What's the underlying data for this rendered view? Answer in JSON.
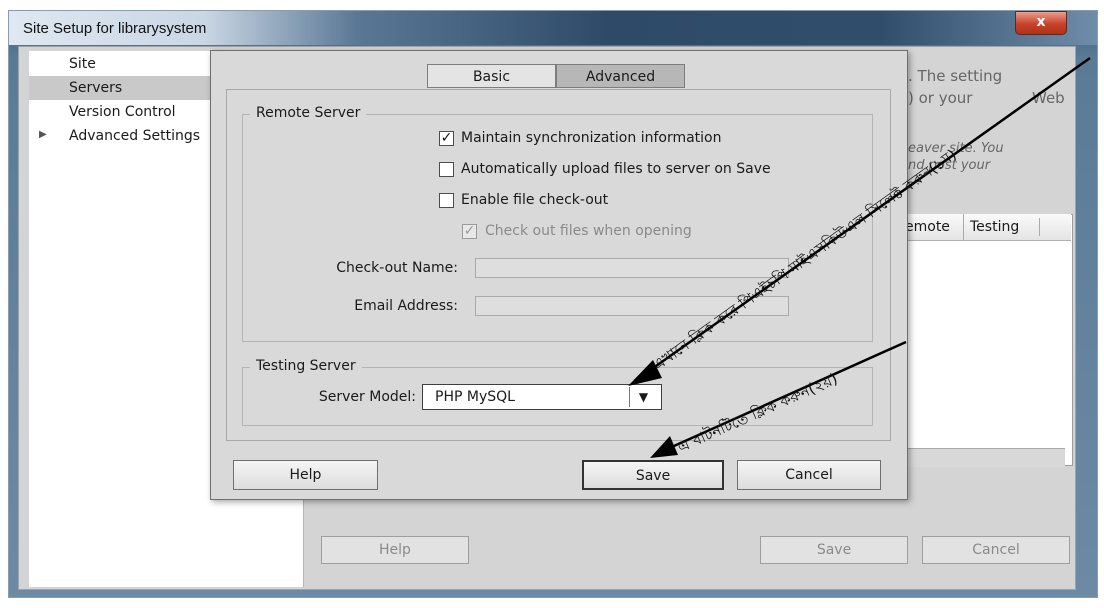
{
  "window": {
    "title": "Site Setup for librarysystem",
    "close_label": "x"
  },
  "sidebar": {
    "items": [
      {
        "label": "Site"
      },
      {
        "label": "Servers"
      },
      {
        "label": "Version Control"
      },
      {
        "label": "Advanced Settings"
      }
    ],
    "selected": "Servers"
  },
  "background_panel": {
    "text_line1": ". The setting",
    "text_line2": ") or your",
    "text_line2b": "Web",
    "text_line3": "eaver site. You",
    "text_line4": "nd post your",
    "table_columns": [
      "emote",
      "Testing"
    ],
    "help_label": "Help",
    "save_label": "Save",
    "cancel_label": "Cancel"
  },
  "dialog": {
    "tabs": [
      {
        "label": "Basic",
        "active": false
      },
      {
        "label": "Advanced",
        "active": true
      }
    ],
    "remote_server": {
      "legend": "Remote Server",
      "maintain_sync": {
        "label": "Maintain synchronization information",
        "checked": true
      },
      "auto_upload": {
        "label": "Automatically upload files to server on Save",
        "checked": false
      },
      "enable_checkout": {
        "label": "Enable file check-out",
        "checked": false
      },
      "checkout_when_opening": {
        "label": "Check out files when opening",
        "checked": true,
        "disabled": true
      },
      "checkout_name_label": "Check-out Name:",
      "checkout_name_value": "",
      "email_label": "Email Address:",
      "email_value": ""
    },
    "testing_server": {
      "legend": "Testing Server",
      "server_model_label": "Server Model:",
      "server_model_value": "PHP MySQL"
    },
    "buttons": {
      "help": "Help",
      "save": "Save",
      "cancel": "Cancel"
    }
  },
  "annotations": {
    "first": "এখানে ক্লিক করে পিএইচপি মাইএসকিউএল সিলেক্ট করুন(১ম)",
    "second": "এ বাটনটিতে ক্লিক করুন(২য়)"
  },
  "colors": {
    "dialog_bg": "#d9d9d9",
    "title_gradient_dark": "#2e4a66",
    "close_red": "#c8412a",
    "arrow": "#000000"
  }
}
